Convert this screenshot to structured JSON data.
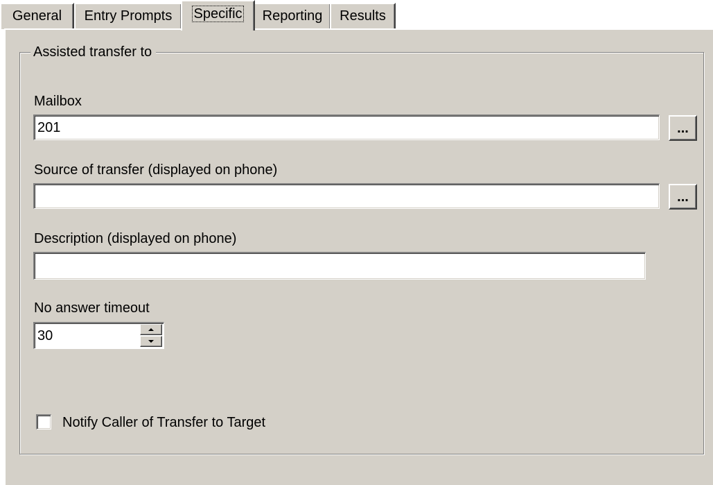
{
  "tabs": [
    {
      "label": "General",
      "active": false
    },
    {
      "label": "Entry Prompts",
      "active": false
    },
    {
      "label": "Specific",
      "active": true
    },
    {
      "label": "Reporting",
      "active": false
    },
    {
      "label": "Results",
      "active": false
    }
  ],
  "group": {
    "title": "Assisted transfer to"
  },
  "mailbox": {
    "label": "Mailbox",
    "value": "201",
    "browse_label": "..."
  },
  "source": {
    "label": "Source of transfer (displayed on phone)",
    "value": "",
    "browse_label": "..."
  },
  "description": {
    "label": "Description (displayed on phone)",
    "value": ""
  },
  "timeout": {
    "label": "No answer timeout",
    "value": "30"
  },
  "notify": {
    "label": "Notify Caller of Transfer to Target",
    "checked": false
  },
  "colors": {
    "face": "#d4d0c8",
    "highlight": "#ffffff",
    "shadow": "#808080",
    "dark_shadow": "#404040"
  }
}
